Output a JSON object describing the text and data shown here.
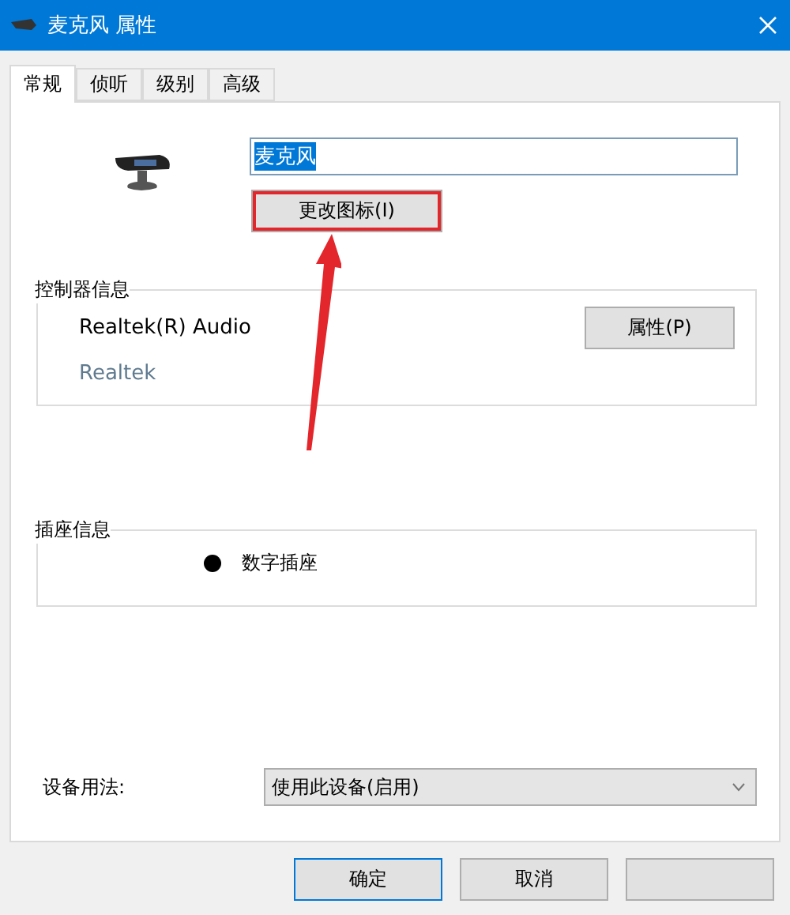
{
  "window": {
    "title": "麦克风 属性"
  },
  "tabs": [
    {
      "label": "常规",
      "selected": true
    },
    {
      "label": "侦听",
      "selected": false
    },
    {
      "label": "级别",
      "selected": false
    },
    {
      "label": "高级",
      "selected": false
    }
  ],
  "device_name": {
    "value": "麦克风",
    "text_selected": true
  },
  "change_icon_button": {
    "label": "更改图标(I)",
    "highlighted": true
  },
  "controller": {
    "title": "控制器信息",
    "name": "Realtek(R) Audio",
    "vendor": "Realtek",
    "button": "属性(P)"
  },
  "jack": {
    "title": "插座信息",
    "items": [
      {
        "label": "数字插座",
        "color": "#000000"
      }
    ]
  },
  "usage": {
    "label": "设备用法:",
    "value": "使用此设备(启用)"
  },
  "buttons": [
    {
      "label": "确定",
      "default": true
    },
    {
      "label": "取消",
      "default": false
    },
    {
      "default": false
    }
  ],
  "annotations": [
    {
      "kind": "arrow"
    }
  ]
}
